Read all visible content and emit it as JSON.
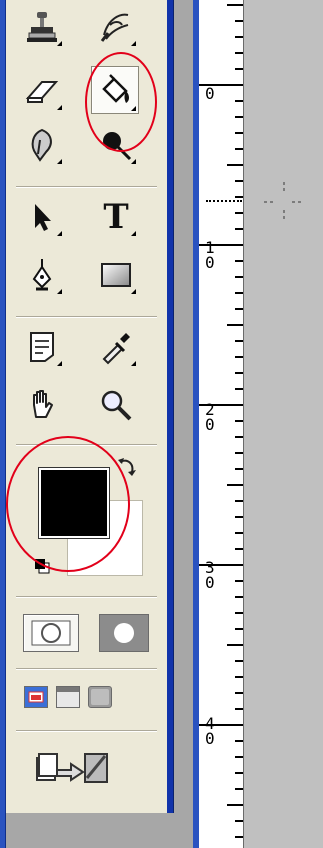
{
  "tools": [
    {
      "name": "clone-stamp",
      "icon": "clone-stamp-icon"
    },
    {
      "name": "history-brush",
      "icon": "history-brush-icon"
    },
    {
      "name": "eraser",
      "icon": "eraser-icon"
    },
    {
      "name": "paint-bucket",
      "icon": "paint-bucket-icon",
      "active": true
    },
    {
      "name": "blur",
      "icon": "blur-icon"
    },
    {
      "name": "burn",
      "icon": "burn-icon"
    },
    {
      "name": "move-select",
      "icon": "arrow-icon"
    },
    {
      "name": "type",
      "icon": "type-icon",
      "glyph": "T"
    },
    {
      "name": "pen",
      "icon": "pen-icon"
    },
    {
      "name": "rectangle",
      "icon": "rectangle-icon"
    },
    {
      "name": "notes",
      "icon": "notes-icon"
    },
    {
      "name": "eyedropper",
      "icon": "eyedropper-icon"
    },
    {
      "name": "hand",
      "icon": "hand-icon"
    },
    {
      "name": "zoom",
      "icon": "zoom-icon"
    }
  ],
  "colors": {
    "foreground": "#000000",
    "background": "#ffffff",
    "highlight": "#e2001a",
    "window_blue": "#2a53c0"
  },
  "ruler": {
    "labels": [
      {
        "digits": [
          "0"
        ]
      },
      {
        "digits": [
          "1",
          "0"
        ]
      },
      {
        "digits": [
          "2",
          "0"
        ]
      },
      {
        "digits": [
          "3",
          "0"
        ]
      },
      {
        "digits": [
          "4",
          "0"
        ]
      }
    ]
  }
}
